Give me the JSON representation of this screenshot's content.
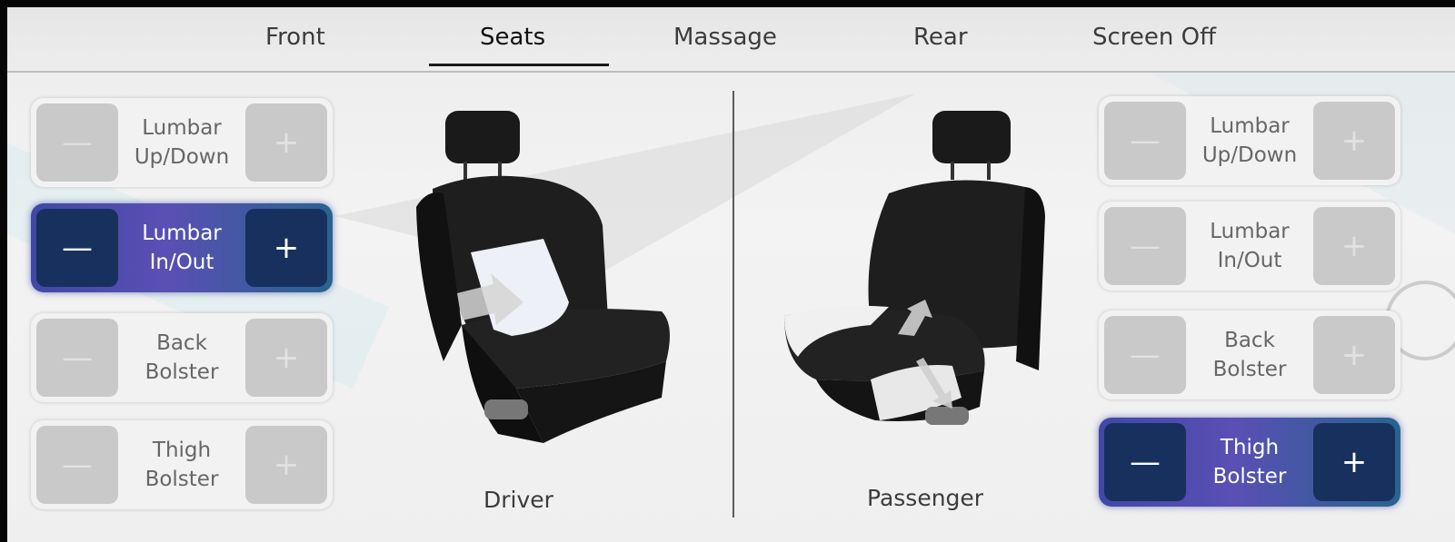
{
  "tabs": [
    "Front",
    "Seats",
    "Massage",
    "Rear",
    "Screen Off"
  ],
  "active_tab": "Seats",
  "driver": {
    "title": "Driver",
    "controls": [
      {
        "label_line1": "Lumbar",
        "label_line2": "Up/Down",
        "minus": "—",
        "plus": "+",
        "active": false
      },
      {
        "label_line1": "Lumbar",
        "label_line2": "In/Out",
        "minus": "—",
        "plus": "+",
        "active": true
      },
      {
        "label_line1": "Back",
        "label_line2": "Bolster",
        "minus": "—",
        "plus": "+",
        "active": false
      },
      {
        "label_line1": "Thigh",
        "label_line2": "Bolster",
        "minus": "—",
        "plus": "+",
        "active": false
      }
    ]
  },
  "passenger": {
    "title": "Passenger",
    "controls": [
      {
        "label_line1": "Lumbar",
        "label_line2": "Up/Down",
        "minus": "—",
        "plus": "+",
        "active": false
      },
      {
        "label_line1": "Lumbar",
        "label_line2": "In/Out",
        "minus": "—",
        "plus": "+",
        "active": false
      },
      {
        "label_line1": "Back",
        "label_line2": "Bolster",
        "minus": "—",
        "plus": "+",
        "active": false
      },
      {
        "label_line1": "Thigh",
        "label_line2": "Bolster",
        "minus": "—",
        "plus": "+",
        "active": true
      }
    ]
  },
  "colors": {
    "active_start": "#4048a6",
    "active_end": "#27648e",
    "active_button": "#17305e",
    "inactive_button": "#c9c9c9"
  }
}
